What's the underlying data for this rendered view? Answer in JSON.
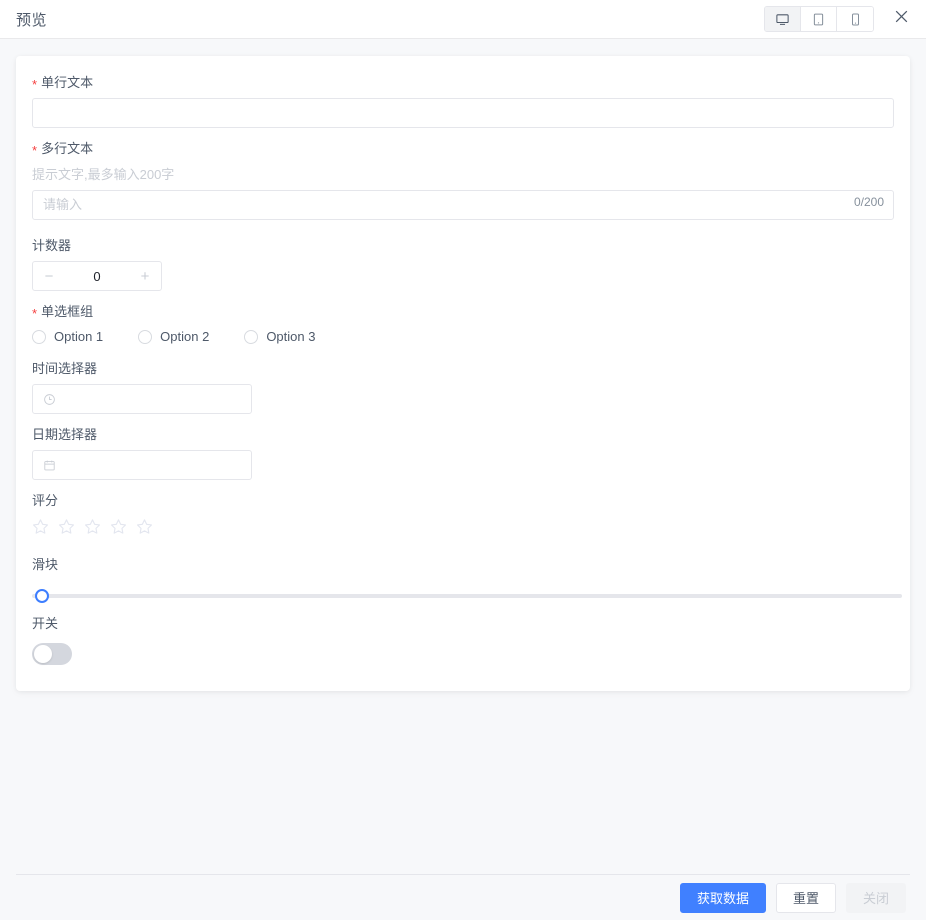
{
  "header": {
    "title": "预览",
    "devices": [
      {
        "name": "desktop",
        "icon": "desktop-icon",
        "active": true
      },
      {
        "name": "tablet",
        "icon": "tablet-icon",
        "active": false
      },
      {
        "name": "mobile",
        "icon": "mobile-icon",
        "active": false
      }
    ],
    "close_icon": "close-icon"
  },
  "form": {
    "single_text": {
      "label": "单行文本",
      "required": true,
      "value": "",
      "placeholder": ""
    },
    "multi_text": {
      "label": "多行文本",
      "required": true,
      "hint": "提示文字,最多输入200字",
      "value": "",
      "placeholder": "请输入",
      "counter": "0/200",
      "max_length": 200
    },
    "counter": {
      "label": "计数器",
      "required": false,
      "value": "0",
      "minus_label": "−",
      "plus_label": "+"
    },
    "radio_group": {
      "label": "单选框组",
      "required": true,
      "options": [
        {
          "label": "Option 1",
          "selected": false
        },
        {
          "label": "Option 2",
          "selected": false
        },
        {
          "label": "Option 3",
          "selected": false
        }
      ]
    },
    "time_picker": {
      "label": "时间选择器",
      "required": false,
      "value": "",
      "icon": "clock-icon"
    },
    "date_picker": {
      "label": "日期选择器",
      "required": false,
      "value": "",
      "icon": "calendar-icon"
    },
    "rating": {
      "label": "评分",
      "required": false,
      "value": 0,
      "max": 5,
      "star_icon": "star-icon"
    },
    "slider": {
      "label": "滑块",
      "required": false,
      "value": 0,
      "min": 0,
      "max": 100
    },
    "switch": {
      "label": "开关",
      "required": false,
      "checked": false
    }
  },
  "footer": {
    "buttons": [
      {
        "label": "获取数据",
        "type": "primary",
        "disabled": false
      },
      {
        "label": "重置",
        "type": "default",
        "disabled": false
      },
      {
        "label": "关闭",
        "type": "disabled",
        "disabled": true
      }
    ]
  },
  "colors": {
    "primary": "#4080ff",
    "slider_accent": "#3d7eff",
    "required_star": "#f53f3f",
    "page_background": "#f7f8fa",
    "card_background": "#ffffff",
    "border": "#e5e6eb",
    "label_text": "#4e5969",
    "placeholder_text": "#c9cdd4"
  }
}
